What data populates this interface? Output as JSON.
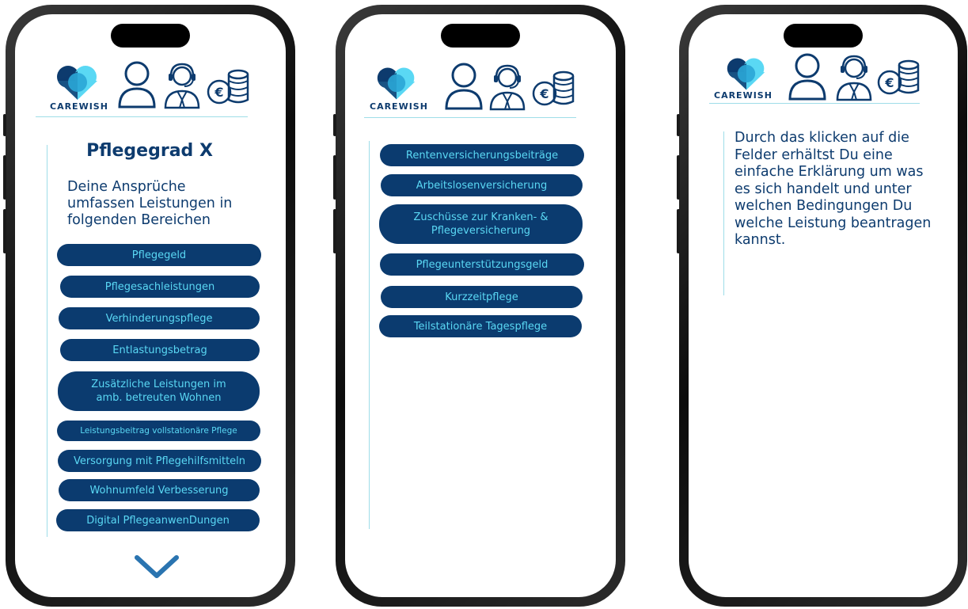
{
  "brand": {
    "name": "CAREWISH"
  },
  "icons": [
    "heart-logo-icon",
    "person-icon",
    "support-agent-icon",
    "euro-coins-icon",
    "chevron-down-icon"
  ],
  "colors": {
    "pill_bg": "#0b3b6f",
    "pill_text": "#5ad8f4",
    "text": "#0d3b6e",
    "divider": "#9edde8"
  },
  "screen1": {
    "title": "Pflegegrad X",
    "intro": "Deine Ansprüche umfassen Leistungen in folgenden Bereichen",
    "items": [
      "Pflegegeld",
      "Pflegesachleistungen",
      "Verhinderungspflege",
      "Entlastungsbetrag",
      "Zusätzliche Leistungen im amb. betreuten Wohnen",
      "Leistungsbeitrag vollstationäre Pflege",
      "Versorgung mit Pflegehilfsmitteln",
      "Wohnumfeld Verbesserung",
      "Digital PflegeanwenDungen"
    ]
  },
  "screen2": {
    "items": [
      "Rentenversicherungsbeiträge",
      "Arbeitslosenversicherung",
      "Zuschüsse zur Kranken- & Pflegeversicherung",
      "Pflegeunterstützungsgeld",
      "Kurzzeitpflege",
      "Teilstationäre Tagespflege"
    ]
  },
  "screen3": {
    "info": "Durch das klicken auf die Felder erhältst Du eine einfache Erklärung um was es sich handelt und unter welchen Bedingungen Du welche Leistung beantragen kannst."
  }
}
